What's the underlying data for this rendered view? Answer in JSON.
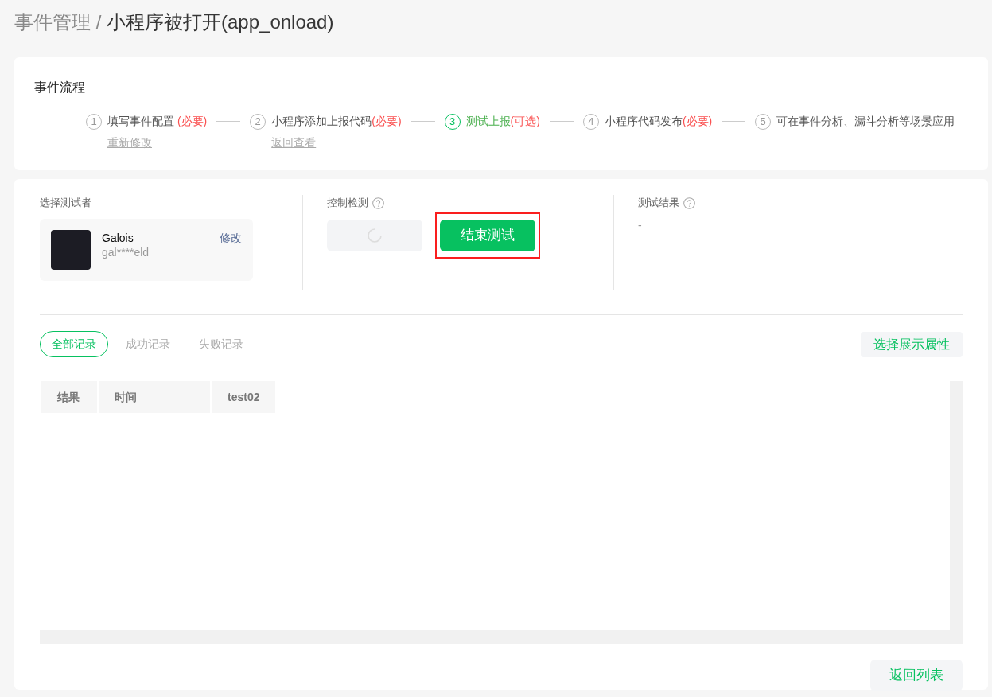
{
  "breadcrumb": {
    "parent": "事件管理",
    "separator": "/",
    "current": "小程序被打开(app_onload)"
  },
  "flow": {
    "title": "事件流程",
    "steps": [
      {
        "number": "1",
        "label": "填写事件配置 ",
        "tag": "(必要)",
        "current": false,
        "link": "重新修改"
      },
      {
        "number": "2",
        "label": "小程序添加上报代码",
        "tag": "(必要)",
        "current": false,
        "link": "返回查看"
      },
      {
        "number": "3",
        "label": "测试上报",
        "tag": "(可选)",
        "current": true
      },
      {
        "number": "4",
        "label": "小程序代码发布",
        "tag": "(必要)",
        "current": false
      },
      {
        "number": "5",
        "label": "可在事件分析、漏斗分析等场景应用",
        "current": false
      }
    ]
  },
  "tester": {
    "title": "选择测试者",
    "name": "Galois",
    "account": "gal****eld",
    "edit": "修改"
  },
  "control": {
    "title": "控制检测",
    "loading": true,
    "button": "结束测试",
    "highlighted": true
  },
  "result": {
    "title": "测试结果",
    "value": "-"
  },
  "tabs": [
    {
      "label": "全部记录",
      "selected": true
    },
    {
      "label": "成功记录",
      "selected": false
    },
    {
      "label": "失败记录",
      "selected": false
    }
  ],
  "attributes_button": "选择展示属性",
  "table": {
    "columns": [
      "结果",
      "时间",
      "test02"
    ]
  },
  "back_button": "返回列表"
}
